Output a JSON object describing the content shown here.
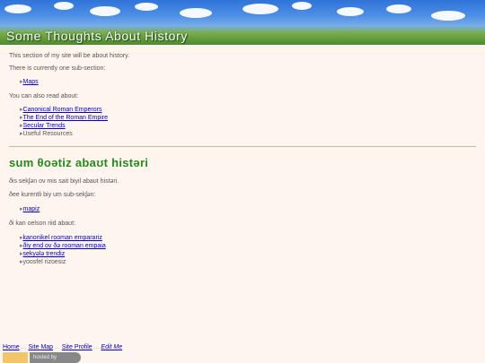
{
  "header": {
    "title": "Some Thoughts About History"
  },
  "intro": {
    "line1": "This section of my site will be about history.",
    "line2": "There is currently one sub-section:",
    "subsections": [
      {
        "label": "Maps",
        "link": true
      }
    ],
    "also_read": "You can also read about:",
    "related": [
      {
        "label": "Canonical Roman Emperors",
        "link": true
      },
      {
        "label": "The End of the Roman Empire",
        "link": true
      },
      {
        "label": "Secular Trends",
        "link": true
      },
      {
        "label": "Useful Resources",
        "link": false
      }
    ]
  },
  "phonetic": {
    "heading": "sum θoətiz abaʊt histəri",
    "line1": "ðis sekʃən ov mis sait biyil abaʊt histəri.",
    "line2": "ðee kurentli biy um sub-sekʃən:",
    "subsections": [
      {
        "label": "mapiz",
        "link": true
      }
    ],
    "also_read": "ði kan oelson riid abaʊt:",
    "related": [
      {
        "label": "kanonikel rooman emparariz",
        "link": true
      },
      {
        "label": "ðiy end ov ðə rooman empaia",
        "link": true
      },
      {
        "label": "sekyələ trendiz",
        "link": true
      },
      {
        "label": "yoosfel rizoesiz",
        "link": false
      }
    ]
  },
  "footer": {
    "home": "Home",
    "sitemap": "Site Map",
    "profile": "Site Profile",
    "edit": "Edit Me",
    "sep": "...",
    "hosted": "hosted by"
  },
  "colors": {
    "background": "#fff5ef",
    "heading_green": "#238a1e",
    "link": "#0000cc"
  },
  "bullet_glyph": "▸"
}
